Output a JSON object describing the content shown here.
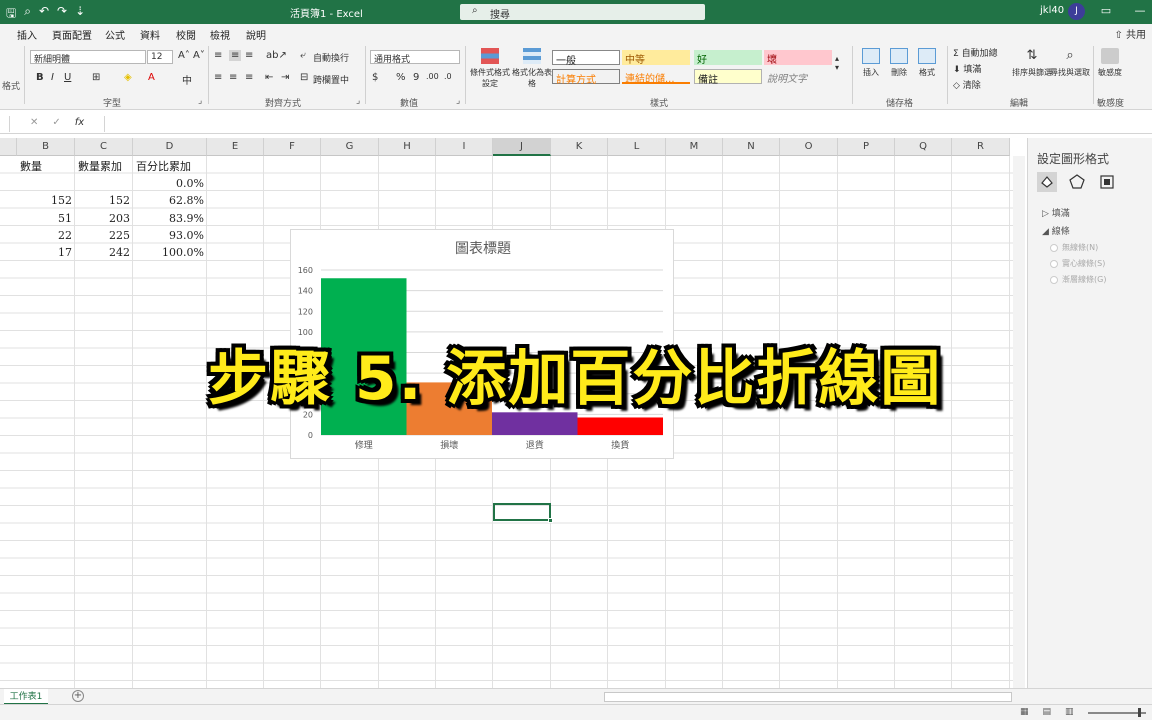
{
  "titlebar": {
    "doc_title": "活頁簿1 - Excel",
    "search_placeholder": "搜尋",
    "user": "jkl40",
    "avatar_initial": "J"
  },
  "menubar": {
    "tabs": [
      "插入",
      "頁面配置",
      "公式",
      "資料",
      "校閱",
      "檢視",
      "說明"
    ],
    "share": "共用"
  },
  "ribbon": {
    "font_name": "新細明體",
    "font_size": "12",
    "number_format": "通用格式",
    "wrap_text": "自動換行",
    "merge_center": "跨欄置中",
    "groups": [
      "格式",
      "字型",
      "對齊方式",
      "數值",
      "樣式",
      "儲存格",
      "編輯",
      "敏感度"
    ],
    "cond_format": "條件式格式設定",
    "format_table": "格式化為表格",
    "styles": [
      "一般",
      "中等",
      "好",
      "壞",
      "計算方式",
      "連結的儲...",
      "備註",
      "說明文字"
    ],
    "insert": "插入",
    "delete": "刪除",
    "format": "格式",
    "autosum": "自動加總",
    "fill": "填滿",
    "clear": "清除",
    "sort_filter": "排序與篩選",
    "find_select": "尋找與選取",
    "sensitivity": "敏感度"
  },
  "formula": {
    "fx": "fx"
  },
  "columns": [
    "B",
    "C",
    "D",
    "E",
    "F",
    "G",
    "H",
    "I",
    "J",
    "K",
    "L",
    "M",
    "N",
    "O",
    "P",
    "Q",
    "R"
  ],
  "table": {
    "headers": [
      "數量",
      "數量累加",
      "百分比累加"
    ],
    "rows": [
      [
        "",
        "",
        "0.0%"
      ],
      [
        "152",
        "152",
        "62.8%"
      ],
      [
        "51",
        "203",
        "83.9%"
      ],
      [
        "22",
        "225",
        "93.0%"
      ],
      [
        "17",
        "242",
        "100.0%"
      ]
    ]
  },
  "chart_data": {
    "type": "bar",
    "title": "圖表標題",
    "categories": [
      "修理",
      "損壞",
      "退貨",
      "換貨"
    ],
    "values": [
      152,
      51,
      22,
      17
    ],
    "colors": [
      "#00b050",
      "#ed7d31",
      "#7030a0",
      "#ff0000"
    ],
    "ylim": [
      0,
      160
    ],
    "yticks": [
      0,
      20,
      40,
      60,
      80,
      100,
      120,
      140,
      160
    ],
    "grid": true
  },
  "overlay": "步驟 5. 添加百分比折線圖",
  "pane": {
    "title": "設定圖形格式",
    "fill_section": "填滿",
    "line_section": "線條",
    "options": [
      "無線條(N)",
      "實心線條(S)",
      "漸層線條(G)"
    ]
  },
  "sheet": {
    "tab": "工作表1"
  }
}
